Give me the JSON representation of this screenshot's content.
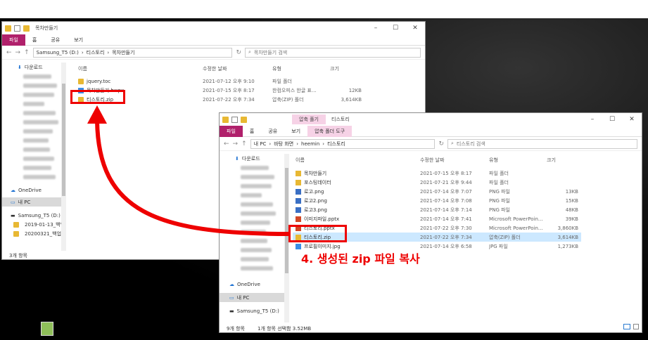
{
  "back_window": {
    "title": "목차만들기",
    "tabs": [
      "파일",
      "홈",
      "공유",
      "보기"
    ],
    "breadcrumb": [
      "Samsung_T5 (D:)",
      "티스토리",
      "목차만들기"
    ],
    "search_placeholder": "목차만들기 검색",
    "columns": [
      "이름",
      "수정한 날짜",
      "유형",
      "크기"
    ],
    "rows": [
      {
        "name": "jquery.toc",
        "date": "2021-07-12 오후 9:10",
        "type": "파일 폴더",
        "size": ""
      },
      {
        "name": "목차만들기.hwpx",
        "date": "2021-07-15 오후 8:17",
        "type": "한컴오피스 한글 표...",
        "size": "12KB"
      },
      {
        "name": "티스토리.zip",
        "date": "2021-07-22 오후 7:34",
        "type": "압축(ZIP) 폴더",
        "size": "3,614KB"
      }
    ],
    "nav": [
      "다운로드",
      "OneDrive",
      "내 PC",
      "Samsung_T5 (D:)",
      "2019-01-13_백업",
      "20200321_백업"
    ],
    "status": "3개 항목"
  },
  "front_window": {
    "context_tab": "압축 풀기",
    "title": "티스토리",
    "tabs": [
      "파일",
      "홈",
      "공유",
      "보기",
      "압축 폴더 도구"
    ],
    "breadcrumb": [
      "내 PC",
      "바탕 화면",
      "heemin",
      "티스토리"
    ],
    "search_placeholder": "티스토리 검색",
    "columns": [
      "이름",
      "수정한 날짜",
      "유형",
      "크기"
    ],
    "rows": [
      {
        "name": "목차만들기",
        "date": "2021-07-15 오후 8:17",
        "type": "파일 폴더",
        "size": "",
        "kind": "folder"
      },
      {
        "name": "포스팅데이터",
        "date": "2021-07-21 오후 9:44",
        "type": "파일 폴더",
        "size": "",
        "kind": "folder"
      },
      {
        "name": "로고.png",
        "date": "2021-07-14 오후 7:07",
        "type": "PNG 파일",
        "size": "13KB",
        "kind": "png"
      },
      {
        "name": "로고2.png",
        "date": "2021-07-14 오후 7:08",
        "type": "PNG 파일",
        "size": "15KB",
        "kind": "png"
      },
      {
        "name": "로고3.png",
        "date": "2021-07-14 오후 7:14",
        "type": "PNG 파일",
        "size": "48KB",
        "kind": "png"
      },
      {
        "name": "이미지파일.pptx",
        "date": "2021-07-14 오후 7:41",
        "type": "Microsoft PowerPoin...",
        "size": "39KB",
        "kind": "ppt"
      },
      {
        "name": "티스토리.pptx",
        "date": "2021-07-22 오후 7:30",
        "type": "Microsoft PowerPoin...",
        "size": "3,860KB",
        "kind": "ppt"
      },
      {
        "name": "티스토리.zip",
        "date": "2021-07-22 오후 7:34",
        "type": "압축(ZIP) 폴더",
        "size": "3,614KB",
        "kind": "zip"
      },
      {
        "name": "프로필이미지.jpg",
        "date": "2021-07-14 오후 6:58",
        "type": "JPG 파일",
        "size": "1,273KB",
        "kind": "jpg"
      }
    ],
    "nav": [
      "다운로드",
      "OneDrive",
      "내 PC",
      "Samsung_T5 (D:)"
    ],
    "status": "9개 항목",
    "status_selected": "1개 항목 선택함 3.52MB"
  },
  "annotation": "4. 생성된 zip 파일 복사",
  "colors": {
    "accent": "#b0206b",
    "red": "#e00000",
    "selection": "#cce8ff"
  }
}
